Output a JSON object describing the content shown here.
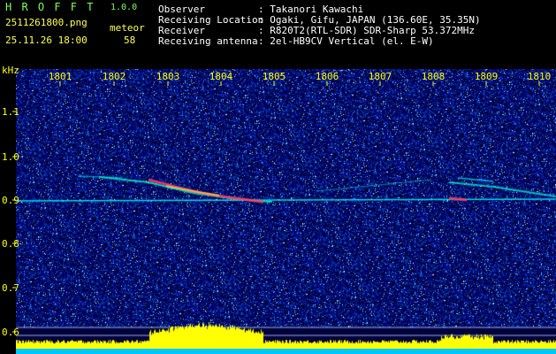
{
  "header": {
    "app_title": "H R O F F T",
    "version": "1.0.0",
    "filename": "2511261800.png",
    "datetime": "25.11.26 18:00",
    "meteor_label": "meteor",
    "meteor_count": "58",
    "info": [
      {
        "label": "Observer",
        "value": ": Takanori Kawachi"
      },
      {
        "label": "Receiving Location",
        "value": ": Ogaki, Gifu, JAPAN (136.60E, 35.35N)"
      },
      {
        "label": "Receiver",
        "value": ": R820T2(RTL-SDR) SDR-Sharp 53.372MHz"
      },
      {
        "label": "Receiving antenna",
        "value": ": 2el-HB9CV Vertical (el. E-W)"
      }
    ]
  },
  "spectrogram": {
    "y_unit": "kHz",
    "x_ticks": [
      "1801",
      "1802",
      "1803",
      "1804",
      "1805",
      "1806",
      "1807",
      "1808",
      "1809",
      "1810"
    ],
    "y_ticks": [
      "1.1",
      "1.0",
      "0.9",
      "0.8",
      "0.7",
      "0.6"
    ],
    "colors": {
      "background": "#000050",
      "tick": "#ffff00",
      "carrier": "#00ffff",
      "meteor": "#ff3060",
      "bars": "#ffff00",
      "base": "#00c8ff"
    }
  }
}
